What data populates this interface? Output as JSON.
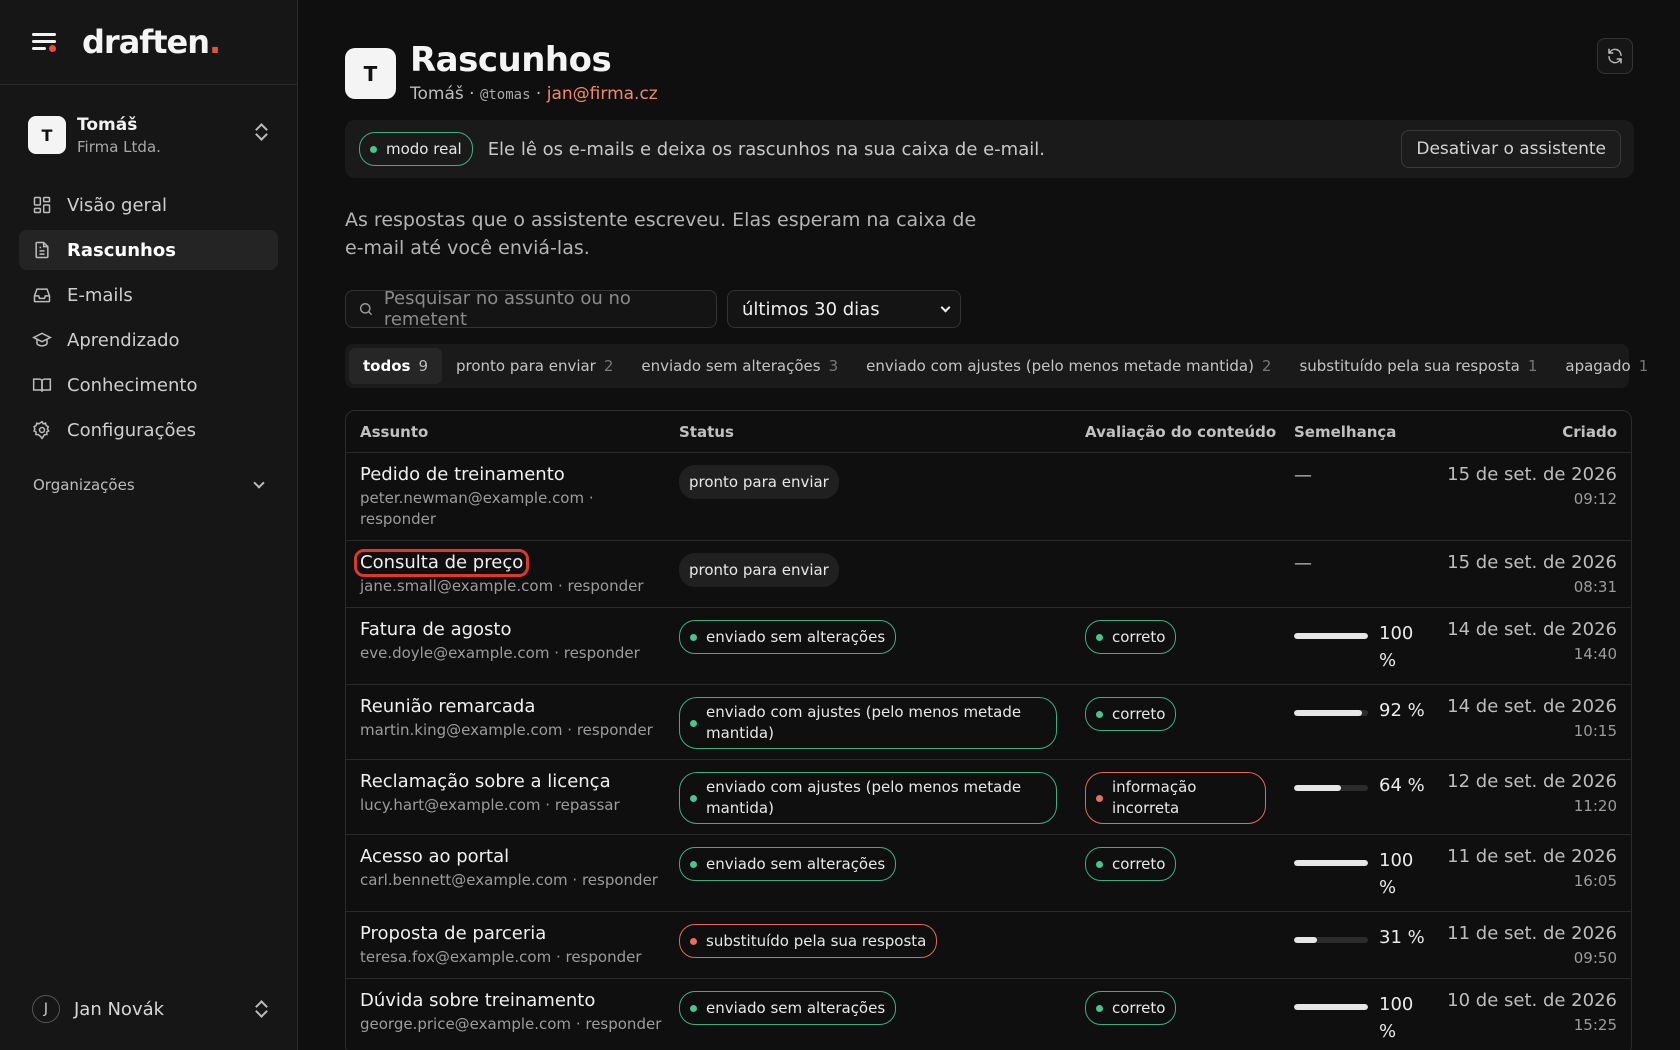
{
  "brand": {
    "name": "draften",
    "dot": "."
  },
  "account": {
    "initial": "T",
    "name": "Tomáš",
    "org": "Firma Ltda."
  },
  "nav": [
    {
      "label": "Visão geral",
      "icon": "dashboard-icon"
    },
    {
      "label": "Rascunhos",
      "icon": "document-icon",
      "active": true
    },
    {
      "label": "E-mails",
      "icon": "inbox-icon"
    },
    {
      "label": "Aprendizado",
      "icon": "graduation-cap-icon"
    },
    {
      "label": "Conhecimento",
      "icon": "book-icon"
    },
    {
      "label": "Configurações",
      "icon": "gear-icon"
    }
  ],
  "orgs_label": "Organizações",
  "user": {
    "initial": "J",
    "name": "Jan Novák"
  },
  "header": {
    "initial": "T",
    "title": "Rascunhos",
    "name": "Tomáš",
    "sep": " · ",
    "handle": "@tomas",
    "email": "jan@firma.cz"
  },
  "banner": {
    "mode": "modo real",
    "text": "Ele lê os e-mails e deixa os rascunhos na sua caixa de e-mail.",
    "button": "Desativar o assistente"
  },
  "description": "As respostas que o assistente escreveu. Elas esperam na caixa de e-mail até você enviá-las.",
  "search": {
    "placeholder": "Pesquisar no assunto ou no remetent"
  },
  "period": {
    "selected": "últimos 30 dias"
  },
  "tabs": [
    {
      "label": "todos",
      "count": "9",
      "active": true
    },
    {
      "label": "pronto para enviar",
      "count": "2"
    },
    {
      "label": "enviado sem alterações",
      "count": "3"
    },
    {
      "label": "enviado com ajustes (pelo menos metade mantida)",
      "count": "2"
    },
    {
      "label": "substituído pela sua resposta",
      "count": "1"
    },
    {
      "label": "apagado",
      "count": "1"
    }
  ],
  "columns": {
    "subject": "Assunto",
    "status": "Status",
    "rating": "Avaliação do conteúdo",
    "similarity": "Semelhança",
    "created": "Criado"
  },
  "rows": [
    {
      "subject": "Pedido de treinamento",
      "meta": "peter.newman@example.com · responder",
      "status": "pronto para enviar",
      "status_kind": "grey",
      "rating": "",
      "rating_kind": "",
      "similarity": "—",
      "sim_value": null,
      "date": "15 de set. de 2026",
      "time": "09:12"
    },
    {
      "subject": "Consulta de preço",
      "meta": "jane.small@example.com · responder",
      "status": "pronto para enviar",
      "status_kind": "grey",
      "rating": "",
      "rating_kind": "",
      "similarity": "—",
      "sim_value": null,
      "date": "15 de set. de 2026",
      "time": "08:31",
      "focused": true
    },
    {
      "subject": "Fatura de agosto",
      "meta": "eve.doyle@example.com · responder",
      "status": "enviado sem alterações",
      "status_kind": "green",
      "rating": "correto",
      "rating_kind": "green",
      "similarity": "100 %",
      "sim_value": 100,
      "date": "14 de set. de 2026",
      "time": "14:40"
    },
    {
      "subject": "Reunião remarcada",
      "meta": "martin.king@example.com · responder",
      "status": "enviado com ajustes (pelo menos metade mantida)",
      "status_kind": "green",
      "rating": "correto",
      "rating_kind": "green",
      "similarity": "92 %",
      "sim_value": 92,
      "date": "14 de set. de 2026",
      "time": "10:15"
    },
    {
      "subject": "Reclamação sobre a licença",
      "meta": "lucy.hart@example.com · repassar",
      "status": "enviado com ajustes (pelo menos metade mantida)",
      "status_kind": "green",
      "rating": "informação incorreta",
      "rating_kind": "red",
      "similarity": "64 %",
      "sim_value": 64,
      "date": "12 de set. de 2026",
      "time": "11:20"
    },
    {
      "subject": "Acesso ao portal",
      "meta": "carl.bennett@example.com · responder",
      "status": "enviado sem alterações",
      "status_kind": "green",
      "rating": "correto",
      "rating_kind": "green",
      "similarity": "100 %",
      "sim_value": 100,
      "date": "11 de set. de 2026",
      "time": "16:05"
    },
    {
      "subject": "Proposta de parceria",
      "meta": "teresa.fox@example.com · responder",
      "status": "substituído pela sua resposta",
      "status_kind": "red",
      "rating": "",
      "rating_kind": "",
      "similarity": "31 %",
      "sim_value": 31,
      "date": "11 de set. de 2026",
      "time": "09:50"
    },
    {
      "subject": "Dúvida sobre treinamento",
      "meta": "george.price@example.com · responder",
      "status": "enviado sem alterações",
      "status_kind": "green",
      "rating": "correto",
      "rating_kind": "green",
      "similarity": "100 %",
      "sim_value": 100,
      "date": "10 de set. de 2026",
      "time": "15:25"
    }
  ]
}
